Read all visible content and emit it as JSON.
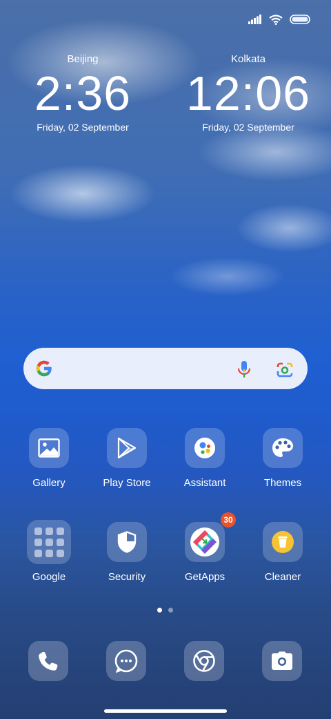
{
  "clocks": [
    {
      "city": "Beijing",
      "time": "2:36",
      "date": "Friday, 02 September"
    },
    {
      "city": "Kolkata",
      "time": "12:06",
      "date": "Friday, 02 September"
    }
  ],
  "status_bar": {
    "icons": [
      "signal-icon",
      "wifi-icon",
      "battery-icon"
    ]
  },
  "search": {
    "icons": [
      "google-g-icon",
      "microphone-icon",
      "camera-lens-icon"
    ]
  },
  "apps_row1": [
    {
      "label": "Gallery",
      "icon": "gallery-icon"
    },
    {
      "label": "Play Store",
      "icon": "play-store-icon"
    },
    {
      "label": "Assistant",
      "icon": "assistant-icon"
    },
    {
      "label": "Themes",
      "icon": "palette-icon"
    }
  ],
  "apps_row2": [
    {
      "label": "Google",
      "icon": "folder-icon"
    },
    {
      "label": "Security",
      "icon": "shield-icon"
    },
    {
      "label": "GetApps",
      "icon": "getapps-icon",
      "badge": "30"
    },
    {
      "label": "Cleaner",
      "icon": "trash-icon"
    }
  ],
  "page_indicator": {
    "pages": 2,
    "active": 1
  },
  "dock": [
    "phone-icon",
    "messages-icon",
    "chrome-icon",
    "camera-icon"
  ],
  "colors": {
    "badge": "#e8532b",
    "google_blue": "#4285F4",
    "google_red": "#EA4335",
    "google_yellow": "#FBBC05",
    "google_green": "#34A853"
  }
}
